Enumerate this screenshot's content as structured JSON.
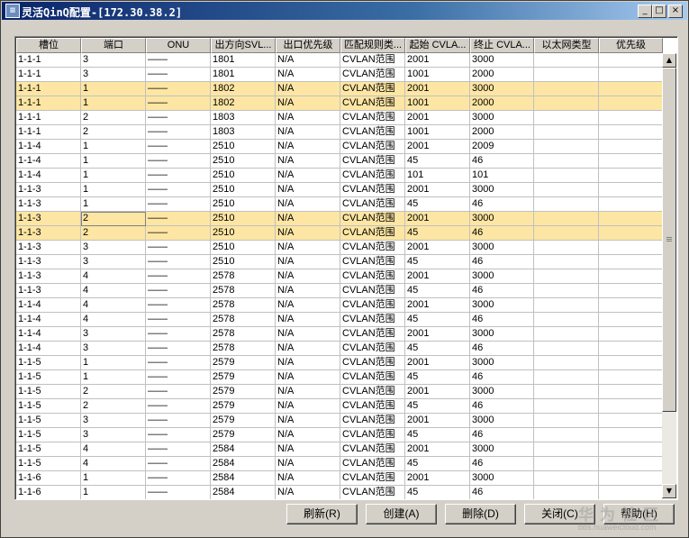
{
  "window": {
    "title": "灵活QinQ配置-[172.30.38.2]",
    "icon": "app-icon",
    "controls": [
      "minimize-icon",
      "maximize-icon",
      "close-icon"
    ]
  },
  "table": {
    "columns": [
      "槽位",
      "端口",
      "ONU",
      "出方向SVL...",
      "出口优先级",
      "匹配规则类...",
      "起始 CVLA...",
      "终止 CVLA...",
      "以太网类型",
      "优先级"
    ],
    "rows": [
      [
        "1-1-1",
        "3",
        "——",
        "1801",
        "N/A",
        "CVLAN范围",
        "2001",
        "3000",
        "",
        ""
      ],
      [
        "1-1-1",
        "3",
        "——",
        "1801",
        "N/A",
        "CVLAN范围",
        "1001",
        "2000",
        "",
        ""
      ],
      [
        "1-1-1",
        "1",
        "——",
        "1802",
        "N/A",
        "CVLAN范围",
        "2001",
        "3000",
        "",
        ""
      ],
      [
        "1-1-1",
        "1",
        "——",
        "1802",
        "N/A",
        "CVLAN范围",
        "1001",
        "2000",
        "",
        ""
      ],
      [
        "1-1-1",
        "2",
        "——",
        "1803",
        "N/A",
        "CVLAN范围",
        "2001",
        "3000",
        "",
        ""
      ],
      [
        "1-1-1",
        "2",
        "——",
        "1803",
        "N/A",
        "CVLAN范围",
        "1001",
        "2000",
        "",
        ""
      ],
      [
        "1-1-4",
        "1",
        "——",
        "2510",
        "N/A",
        "CVLAN范围",
        "2001",
        "2009",
        "",
        ""
      ],
      [
        "1-1-4",
        "1",
        "——",
        "2510",
        "N/A",
        "CVLAN范围",
        "45",
        "46",
        "",
        ""
      ],
      [
        "1-1-4",
        "1",
        "——",
        "2510",
        "N/A",
        "CVLAN范围",
        "101",
        "101",
        "",
        ""
      ],
      [
        "1-1-3",
        "1",
        "——",
        "2510",
        "N/A",
        "CVLAN范围",
        "2001",
        "3000",
        "",
        ""
      ],
      [
        "1-1-3",
        "1",
        "——",
        "2510",
        "N/A",
        "CVLAN范围",
        "45",
        "46",
        "",
        ""
      ],
      [
        "1-1-3",
        "2",
        "——",
        "2510",
        "N/A",
        "CVLAN范围",
        "2001",
        "3000",
        "",
        ""
      ],
      [
        "1-1-3",
        "2",
        "——",
        "2510",
        "N/A",
        "CVLAN范围",
        "45",
        "46",
        "",
        ""
      ],
      [
        "1-1-3",
        "3",
        "——",
        "2510",
        "N/A",
        "CVLAN范围",
        "2001",
        "3000",
        "",
        ""
      ],
      [
        "1-1-3",
        "3",
        "——",
        "2510",
        "N/A",
        "CVLAN范围",
        "45",
        "46",
        "",
        ""
      ],
      [
        "1-1-3",
        "4",
        "——",
        "2578",
        "N/A",
        "CVLAN范围",
        "2001",
        "3000",
        "",
        ""
      ],
      [
        "1-1-3",
        "4",
        "——",
        "2578",
        "N/A",
        "CVLAN范围",
        "45",
        "46",
        "",
        ""
      ],
      [
        "1-1-4",
        "4",
        "——",
        "2578",
        "N/A",
        "CVLAN范围",
        "2001",
        "3000",
        "",
        ""
      ],
      [
        "1-1-4",
        "4",
        "——",
        "2578",
        "N/A",
        "CVLAN范围",
        "45",
        "46",
        "",
        ""
      ],
      [
        "1-1-4",
        "3",
        "——",
        "2578",
        "N/A",
        "CVLAN范围",
        "2001",
        "3000",
        "",
        ""
      ],
      [
        "1-1-4",
        "3",
        "——",
        "2578",
        "N/A",
        "CVLAN范围",
        "45",
        "46",
        "",
        ""
      ],
      [
        "1-1-5",
        "1",
        "——",
        "2579",
        "N/A",
        "CVLAN范围",
        "2001",
        "3000",
        "",
        ""
      ],
      [
        "1-1-5",
        "1",
        "——",
        "2579",
        "N/A",
        "CVLAN范围",
        "45",
        "46",
        "",
        ""
      ],
      [
        "1-1-5",
        "2",
        "——",
        "2579",
        "N/A",
        "CVLAN范围",
        "2001",
        "3000",
        "",
        ""
      ],
      [
        "1-1-5",
        "2",
        "——",
        "2579",
        "N/A",
        "CVLAN范围",
        "45",
        "46",
        "",
        ""
      ],
      [
        "1-1-5",
        "3",
        "——",
        "2579",
        "N/A",
        "CVLAN范围",
        "2001",
        "3000",
        "",
        ""
      ],
      [
        "1-1-5",
        "3",
        "——",
        "2579",
        "N/A",
        "CVLAN范围",
        "45",
        "46",
        "",
        ""
      ],
      [
        "1-1-5",
        "4",
        "——",
        "2584",
        "N/A",
        "CVLAN范围",
        "2001",
        "3000",
        "",
        ""
      ],
      [
        "1-1-5",
        "4",
        "——",
        "2584",
        "N/A",
        "CVLAN范围",
        "45",
        "46",
        "",
        ""
      ],
      [
        "1-1-6",
        "1",
        "——",
        "2584",
        "N/A",
        "CVLAN范围",
        "2001",
        "3000",
        "",
        ""
      ],
      [
        "1-1-6",
        "1",
        "——",
        "2584",
        "N/A",
        "CVLAN范围",
        "45",
        "46",
        "",
        ""
      ]
    ],
    "highlighted_rows": [
      2,
      3,
      11,
      12
    ],
    "highlight_color": "#fde6a3",
    "focused_cell": {
      "row": 11,
      "col": 1
    }
  },
  "buttons": {
    "refresh": "刷新(R)",
    "create": "创建(A)",
    "delete": "删除(D)",
    "close": "关闭(C)",
    "help": "帮助(H)"
  },
  "watermark": {
    "main": "华为社区",
    "sub": "bbs.huaweicloud.com"
  },
  "colors": {
    "titlebar_start": "#0a246a",
    "titlebar_end": "#a6caf0",
    "highlight": "#fde6a3",
    "face": "#d4d0c8"
  }
}
